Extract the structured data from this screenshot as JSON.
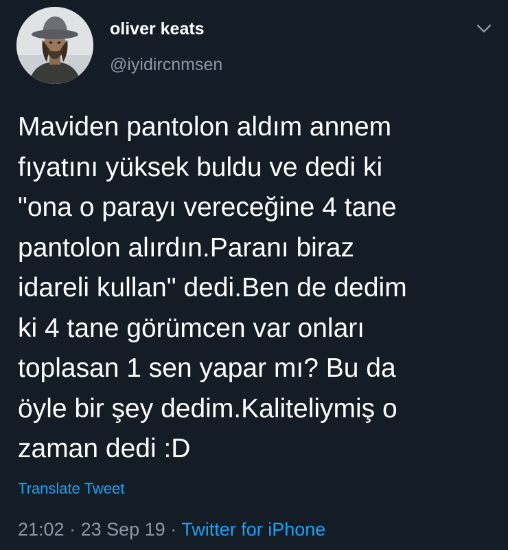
{
  "colors": {
    "background": "#141d26",
    "text_primary": "#ffffff",
    "text_secondary": "#8899a6",
    "accent": "#1da1f2"
  },
  "user": {
    "display_name": "oliver keats",
    "handle": "@iyidircnmsen",
    "avatar_icon": "profile-photo"
  },
  "menu": {
    "icon": "chevron-down-icon"
  },
  "tweet": {
    "text": "Maviden pantolon aldım annem\nfıyatını yüksek buldu ve dedi ki\n\"ona o parayı vereceğine 4 tane\npantolon alırdın.Paranı biraz\nidareli kullan\" dedi.Ben de dedim\nki 4 tane görümcen var onları\ntoplasan 1 sen yapar mı? Bu da\nöyle bir şey dedim.Kaliteliymiş o\nzaman dedi :D",
    "translate_label": "Translate Tweet",
    "time": "21:02",
    "separator": " · ",
    "date": "23 Sep 19",
    "source": "Twitter for iPhone"
  }
}
